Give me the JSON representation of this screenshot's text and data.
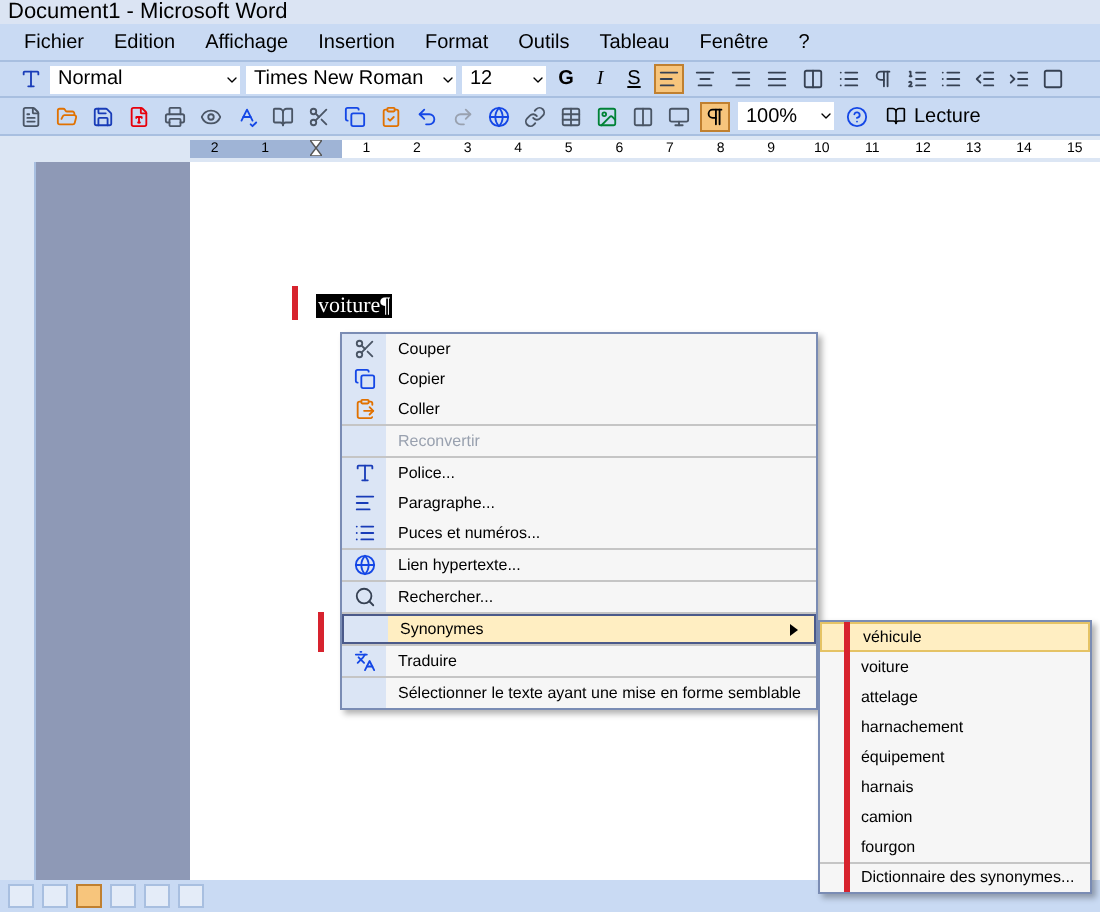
{
  "window": {
    "title": "Document1 - Microsoft Word"
  },
  "menu_bar": [
    "Fichier",
    "Edition",
    "Affichage",
    "Insertion",
    "Format",
    "Outils",
    "Tableau",
    "Fenêtre",
    "?"
  ],
  "formatting_toolbar": {
    "style": "Normal",
    "font": "Times New Roman",
    "size": "12",
    "bold_label": "G",
    "italic_label": "I",
    "underline_label": "S",
    "alignments": [
      {
        "selected": true
      },
      {
        "selected": false
      },
      {
        "selected": false
      },
      {
        "selected": false
      },
      {
        "selected": false
      }
    ]
  },
  "standard_toolbar": {
    "zoom": "100%",
    "reading_button": "Lecture",
    "show_marks": true
  },
  "ruler": {
    "left_labels": [
      "2",
      "1"
    ],
    "labels": [
      "1",
      "2",
      "3",
      "4",
      "5",
      "6",
      "7",
      "8",
      "9",
      "10",
      "11",
      "12",
      "13",
      "14",
      "15"
    ]
  },
  "document": {
    "selected_word": "voiture",
    "pilcrow": "¶"
  },
  "context_menu": {
    "groups": [
      [
        {
          "label": "Couper",
          "disabled": false,
          "selected": false
        },
        {
          "label": "Copier",
          "disabled": false,
          "selected": false
        },
        {
          "label": "Coller",
          "disabled": false,
          "selected": false
        }
      ],
      [
        {
          "label": "Reconvertir",
          "disabled": true,
          "selected": false
        }
      ],
      [
        {
          "label": "Police...",
          "disabled": false,
          "selected": false
        },
        {
          "label": "Paragraphe...",
          "disabled": false,
          "selected": false
        },
        {
          "label": "Puces et numéros...",
          "disabled": false,
          "selected": false
        }
      ],
      [
        {
          "label": "Lien hypertexte...",
          "disabled": false,
          "selected": false
        }
      ],
      [
        {
          "label": "Rechercher...",
          "disabled": false,
          "selected": false
        }
      ],
      [
        {
          "label": "Synonymes",
          "disabled": false,
          "selected": true,
          "submenu": true
        }
      ],
      [
        {
          "label": "Traduire",
          "disabled": false,
          "selected": false
        }
      ],
      [
        {
          "label": "Sélectionner le texte ayant une mise en forme semblable",
          "disabled": false,
          "selected": false
        }
      ]
    ]
  },
  "submenu": {
    "items": [
      {
        "label": "véhicule",
        "selected": true
      },
      {
        "label": "voiture",
        "selected": false
      },
      {
        "label": "attelage",
        "selected": false
      },
      {
        "label": "harnachement",
        "selected": false
      },
      {
        "label": "équipement",
        "selected": false
      },
      {
        "label": "harnais",
        "selected": false
      },
      {
        "label": "camion",
        "selected": false
      },
      {
        "label": "fourgon",
        "selected": false
      }
    ],
    "footer": "Dictionnaire des synonymes..."
  }
}
